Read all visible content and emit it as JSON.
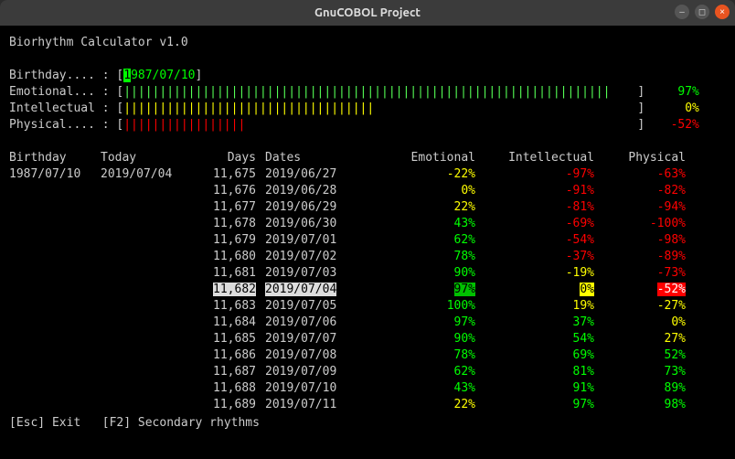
{
  "window": {
    "title": "GnuCOBOL Project"
  },
  "app_title": "Biorhythm Calculator v1.0",
  "input_row": {
    "label": "Birthday.... :",
    "cursor_char": "1",
    "value_rest": "987/07/10"
  },
  "bars": {
    "emotional": {
      "label": "Emotional... :",
      "value": "97%",
      "cls": "green",
      "ticks": "||||||||||||||||||||||||||||||||||||||||||||||||||||||||||||||||||||",
      "bar_cls": "brgreen"
    },
    "intellectual": {
      "label": "Intellectual :",
      "value": "0%",
      "cls": "yellow",
      "ticks": "|||||||||||||||||||||||||||||||||||",
      "bar_cls": "yellow"
    },
    "physical": {
      "label": "Physical.... :",
      "value": "-52%",
      "cls": "red",
      "ticks": "|||||||||||||||||",
      "bar_cls": "red"
    }
  },
  "table_headers": {
    "birthday": "Birthday",
    "today": "Today",
    "days": "Days",
    "dates": "Dates",
    "emotional": "Emotional",
    "intellectual": "Intellectual",
    "physical": "Physical"
  },
  "birthday": "1987/07/10",
  "today": "2019/07/04",
  "rows": [
    {
      "days": "11,675",
      "date": "2019/06/27",
      "emo": "-22%",
      "ecls": "yellow",
      "intl": "-97%",
      "icls": "red",
      "phys": "-63%",
      "pcls": "red"
    },
    {
      "days": "11,676",
      "date": "2019/06/28",
      "emo": "0%",
      "ecls": "yellow",
      "intl": "-91%",
      "icls": "red",
      "phys": "-82%",
      "pcls": "red"
    },
    {
      "days": "11,677",
      "date": "2019/06/29",
      "emo": "22%",
      "ecls": "yellow",
      "intl": "-81%",
      "icls": "red",
      "phys": "-94%",
      "pcls": "red"
    },
    {
      "days": "11,678",
      "date": "2019/06/30",
      "emo": "43%",
      "ecls": "green",
      "intl": "-69%",
      "icls": "red",
      "phys": "-100%",
      "pcls": "red"
    },
    {
      "days": "11,679",
      "date": "2019/07/01",
      "emo": "62%",
      "ecls": "green",
      "intl": "-54%",
      "icls": "red",
      "phys": "-98%",
      "pcls": "red"
    },
    {
      "days": "11,680",
      "date": "2019/07/02",
      "emo": "78%",
      "ecls": "green",
      "intl": "-37%",
      "icls": "red",
      "phys": "-89%",
      "pcls": "red"
    },
    {
      "days": "11,681",
      "date": "2019/07/03",
      "emo": "90%",
      "ecls": "green",
      "intl": "-19%",
      "icls": "yellow",
      "phys": "-73%",
      "pcls": "red"
    },
    {
      "days": "11,682",
      "date": "2019/07/04",
      "emo": "97%",
      "ecls": "green",
      "intl": "0%",
      "icls": "yellow",
      "phys": "-52%",
      "pcls": "red",
      "hl": true
    },
    {
      "days": "11,683",
      "date": "2019/07/05",
      "emo": "100%",
      "ecls": "green",
      "intl": "19%",
      "icls": "yellow",
      "phys": "-27%",
      "pcls": "yellow"
    },
    {
      "days": "11,684",
      "date": "2019/07/06",
      "emo": "97%",
      "ecls": "green",
      "intl": "37%",
      "icls": "green",
      "phys": "0%",
      "pcls": "yellow"
    },
    {
      "days": "11,685",
      "date": "2019/07/07",
      "emo": "90%",
      "ecls": "green",
      "intl": "54%",
      "icls": "green",
      "phys": "27%",
      "pcls": "yellow"
    },
    {
      "days": "11,686",
      "date": "2019/07/08",
      "emo": "78%",
      "ecls": "green",
      "intl": "69%",
      "icls": "green",
      "phys": "52%",
      "pcls": "green"
    },
    {
      "days": "11,687",
      "date": "2019/07/09",
      "emo": "62%",
      "ecls": "green",
      "intl": "81%",
      "icls": "green",
      "phys": "73%",
      "pcls": "green"
    },
    {
      "days": "11,688",
      "date": "2019/07/10",
      "emo": "43%",
      "ecls": "green",
      "intl": "91%",
      "icls": "green",
      "phys": "89%",
      "pcls": "green"
    },
    {
      "days": "11,689",
      "date": "2019/07/11",
      "emo": "22%",
      "ecls": "yellow",
      "intl": "97%",
      "icls": "green",
      "phys": "98%",
      "pcls": "green"
    }
  ],
  "footer": {
    "esc_key": "[Esc]",
    "esc_text": " Exit   ",
    "f2_key": "[F2]",
    "f2_text": " Secondary rhythms"
  }
}
